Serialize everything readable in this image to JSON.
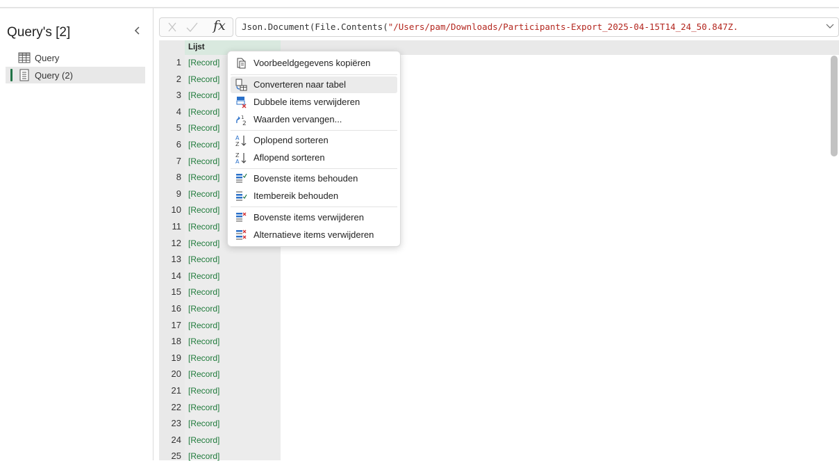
{
  "left_pane": {
    "title": "Query's [2]",
    "queries": [
      {
        "label": "Query"
      },
      {
        "label": "Query (2)"
      }
    ]
  },
  "formula_bar": {
    "fx_label": "fx",
    "formula_prefix": "Json.Document(File.Contents(",
    "formula_string": "\"/Users/pam/Downloads/Participants-Export_2025-04-15T14_24_50.847Z."
  },
  "grid": {
    "column_header": "Lijst",
    "rows": [
      {
        "num": "1",
        "value": "[Record]"
      },
      {
        "num": "2",
        "value": "[Record]"
      },
      {
        "num": "3",
        "value": "[Record]"
      },
      {
        "num": "4",
        "value": "[Record]"
      },
      {
        "num": "5",
        "value": "[Record]"
      },
      {
        "num": "6",
        "value": "[Record]"
      },
      {
        "num": "7",
        "value": "[Record]"
      },
      {
        "num": "8",
        "value": "[Record]"
      },
      {
        "num": "9",
        "value": "[Record]"
      },
      {
        "num": "10",
        "value": "[Record]"
      },
      {
        "num": "11",
        "value": "[Record]"
      },
      {
        "num": "12",
        "value": "[Record]"
      },
      {
        "num": "13",
        "value": "[Record]"
      },
      {
        "num": "14",
        "value": "[Record]"
      },
      {
        "num": "15",
        "value": "[Record]"
      },
      {
        "num": "16",
        "value": "[Record]"
      },
      {
        "num": "17",
        "value": "[Record]"
      },
      {
        "num": "18",
        "value": "[Record]"
      },
      {
        "num": "19",
        "value": "[Record]"
      },
      {
        "num": "20",
        "value": "[Record]"
      },
      {
        "num": "21",
        "value": "[Record]"
      },
      {
        "num": "22",
        "value": "[Record]"
      },
      {
        "num": "23",
        "value": "[Record]"
      },
      {
        "num": "24",
        "value": "[Record]"
      },
      {
        "num": "25",
        "value": "[Record]"
      }
    ]
  },
  "context_menu": {
    "items": [
      {
        "label": "Voorbeeldgegevens kopiëren",
        "icon": "copy-sample-icon"
      },
      {
        "label": "Converteren naar tabel",
        "icon": "convert-to-table-icon"
      },
      {
        "label": "Dubbele items verwijderen",
        "icon": "remove-duplicates-icon"
      },
      {
        "label": "Waarden vervangen...",
        "icon": "replace-values-icon"
      },
      {
        "label": "Oplopend sorteren",
        "icon": "sort-ascending-icon"
      },
      {
        "label": "Aflopend sorteren",
        "icon": "sort-descending-icon"
      },
      {
        "label": "Bovenste items behouden",
        "icon": "keep-top-items-icon"
      },
      {
        "label": "Itembereik behouden",
        "icon": "keep-range-icon"
      },
      {
        "label": "Bovenste items verwijderen",
        "icon": "remove-top-items-icon"
      },
      {
        "label": "Alternatieve items verwijderen",
        "icon": "remove-alternate-items-icon"
      }
    ]
  },
  "colors": {
    "accent_green": "#217346",
    "record_green": "#1e7a3a",
    "formula_string_red": "#b3261e",
    "column_header_bg": "#d9e9df"
  }
}
